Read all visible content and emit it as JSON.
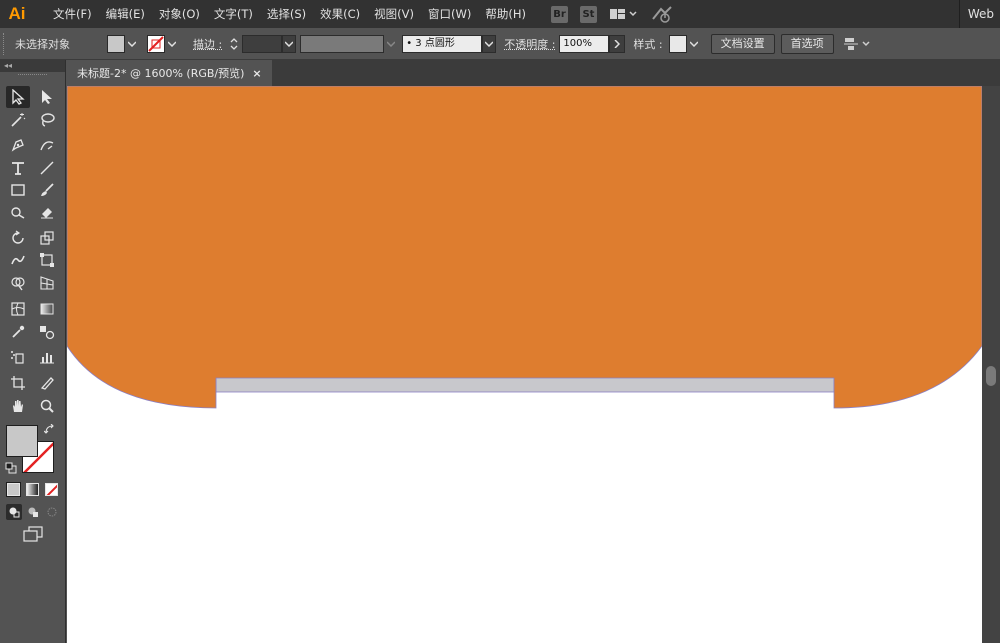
{
  "app": {
    "logo": "Ai",
    "workspace": "Web"
  },
  "menu": {
    "items": [
      "文件(F)",
      "编辑(E)",
      "对象(O)",
      "文字(T)",
      "选择(S)",
      "效果(C)",
      "视图(V)",
      "窗口(W)",
      "帮助(H)"
    ],
    "badges": [
      "Br",
      "St"
    ]
  },
  "control": {
    "selection_status": "未选择对象",
    "stroke_label": "描边 :",
    "brush_value": "•  3 点圆形",
    "opacity_label": "不透明度 :",
    "opacity_value": "100%",
    "style_label": "样式 :",
    "doc_setup_button": "文档设置",
    "preferences_button": "首选项"
  },
  "tools_panel": {
    "collapse_glyph": "◂◂"
  },
  "document": {
    "tab_title": "未标题-2* @ 1600% (RGB/预览)",
    "close_glyph": "×"
  },
  "colors": {
    "orange_shape": "#DE7D2F",
    "gray_bar": "#C8C8CC",
    "shape_outline": "#8A7FC4",
    "canvas": "#FFFFFF",
    "fill_swatch": "#C8C8C8"
  }
}
